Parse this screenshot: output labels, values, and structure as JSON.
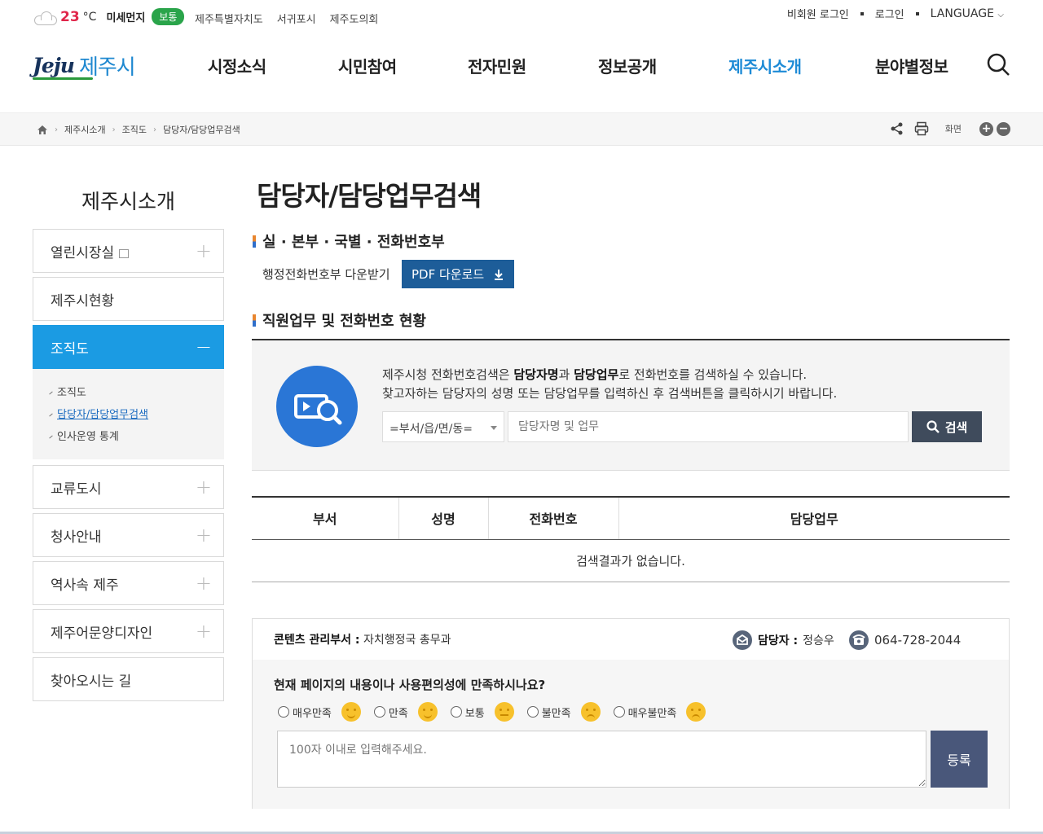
{
  "weather": {
    "temp": "23",
    "unit": "°C",
    "dust_label": "미세먼지",
    "dust_status": "보통"
  },
  "top_links": [
    "제주특별자치도",
    "서귀포시",
    "제주도의회"
  ],
  "right_links": {
    "guest_login": "비회원 로그인",
    "login": "로그인",
    "language": "LANGUAGE"
  },
  "logo": {
    "en": "Jeju",
    "ko": "제주시"
  },
  "gnb": [
    "시정소식",
    "시민참여",
    "전자민원",
    "정보공개",
    "제주시소개",
    "분야별정보"
  ],
  "gnb_active_index": 4,
  "breadcrumb": [
    "제주시소개",
    "조직도",
    "담당자/담당업무검색"
  ],
  "bc_tools": {
    "screen_label": "화면",
    "zoom_in": "+",
    "zoom_out": "−"
  },
  "sidebar": {
    "title": "제주시소개",
    "items": [
      {
        "label": "열린시장실"
      },
      {
        "label": "제주시현황"
      },
      {
        "label": "조직도"
      },
      {
        "label": "교류도시"
      },
      {
        "label": "청사안내"
      },
      {
        "label": "역사속 제주"
      },
      {
        "label": "제주어문양디자인"
      },
      {
        "label": "찾아오시는 길"
      }
    ],
    "subitems": [
      "조직도",
      "담당자/담당업무검색",
      "인사운영 통계"
    ]
  },
  "page_title": "담당자/담당업무검색",
  "section1": {
    "title": "실 · 본부 · 국별 · 전화번호부",
    "download_label": "행정전화번호부 다운받기",
    "pdf_button": "PDF 다운로드"
  },
  "section2": {
    "title": "직원업무 및 전화번호 현황"
  },
  "search": {
    "line1_a": "제주시청 전화번호검색은 ",
    "line1_b": "담당자명",
    "line1_c": "과 ",
    "line1_d": "담당업무",
    "line1_e": "로 전화번호를 검색하실 수 있습니다.",
    "line2": "찾고자하는 담당자의 성명 또는 담당업무를 입력하신 후 검색버튼을 클릭하시기 바랍니다.",
    "select_value": "=부서/읍/면/동=",
    "placeholder": "담당자명 및 업무",
    "button": "검색"
  },
  "table": {
    "headers": [
      "부서",
      "성명",
      "전화번호",
      "담당업무"
    ],
    "empty": "검색결과가 없습니다."
  },
  "content_info": {
    "dept_label": "콘텐츠 관리부서 :",
    "dept_value": "자치행정국 총무과",
    "manager_label": "담당자 :",
    "manager_value": "정승우",
    "phone": "064-728-2044"
  },
  "satisfaction": {
    "question": "현재 페이지의 내용이나 사용편의성에 만족하시나요?",
    "options": [
      "매우만족",
      "만족",
      "보통",
      "불만족",
      "매우불만족"
    ],
    "placeholder": "100자 이내로 입력해주세요.",
    "submit": "등록"
  },
  "colors": {
    "accent": "#1b9be3",
    "nav_active": "#1e8bd6",
    "pdf_button": "#1d5d99",
    "search_button": "#3f4b5c",
    "dust_good": "#2aa44a"
  }
}
